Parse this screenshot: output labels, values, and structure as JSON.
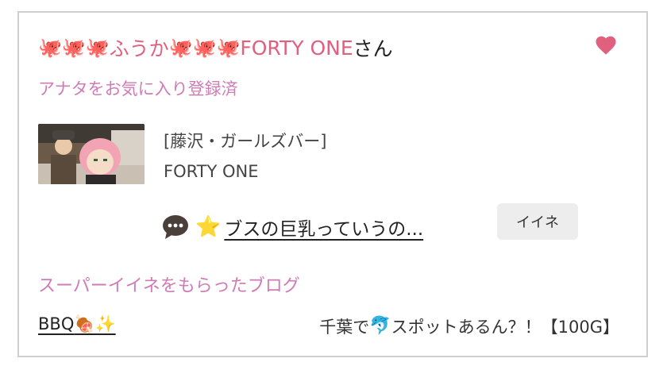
{
  "header": {
    "octopus": "🐙",
    "name_a": "ふうか",
    "name_b": "FORTY ONE",
    "suffix": "さん",
    "favorite_icon": "heart-icon",
    "accent_color": "#e0607e"
  },
  "favorite_status": "アナタをお気に入り登録済",
  "shop": {
    "category": "[藤沢・ガールズバー]",
    "name": "FORTY ONE"
  },
  "comment": {
    "icon": "speech-bubble-icon",
    "star": "⭐",
    "text": "ブスの巨乳っていうの..."
  },
  "iine_button": "イイネ",
  "super_section": {
    "title": "スーパーイイネをもらったブログ",
    "blog_title": "BBQ",
    "blog_emojis": "🍖✨",
    "right_prefix": "千葉で",
    "right_emoji": "🐬",
    "right_suffix": "スポットあるん？！【100G】"
  }
}
